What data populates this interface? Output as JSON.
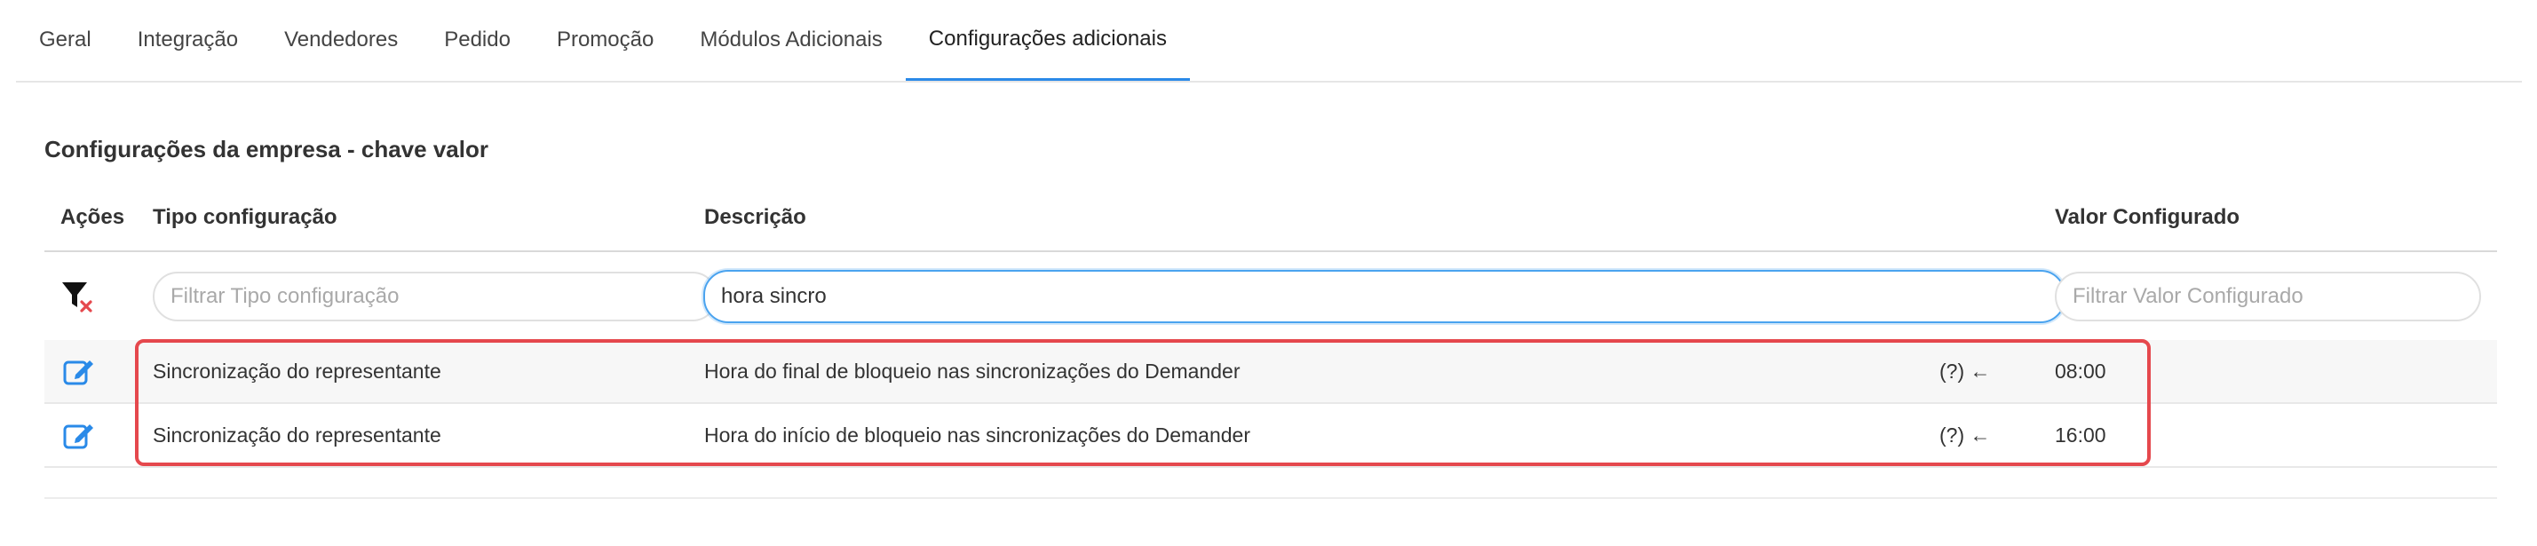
{
  "tabs": [
    {
      "label": "Geral"
    },
    {
      "label": "Integração"
    },
    {
      "label": "Vendedores"
    },
    {
      "label": "Pedido"
    },
    {
      "label": "Promoção"
    },
    {
      "label": "Módulos Adicionais"
    },
    {
      "label": "Configurações adicionais",
      "active": true
    }
  ],
  "section_title": "Configurações da empresa - chave valor",
  "columns": {
    "acoes": "Ações",
    "tipo": "Tipo configuração",
    "descricao": "Descrição",
    "valor": "Valor Configurado"
  },
  "filters": {
    "tipo_placeholder": "Filtrar Tipo configuração",
    "descricao_value": "hora sincro",
    "valor_placeholder": "Filtrar Valor Configurado"
  },
  "rows": [
    {
      "tipo": "Sincronização do representante",
      "descricao": "Hora do final de bloqueio nas sincronizações do Demander",
      "hint": "(?) ←",
      "valor": "08:00"
    },
    {
      "tipo": "Sincronização do representante",
      "descricao": "Hora do início de bloqueio nas sincronizações do Demander",
      "hint": "(?) ←",
      "valor": "16:00"
    }
  ],
  "colors": {
    "accent": "#2a8ae8",
    "highlight": "#e5484d",
    "edit_icon": "#2a8ae8"
  },
  "icons": {
    "filter": "clear-filter-icon",
    "edit": "edit-icon"
  }
}
